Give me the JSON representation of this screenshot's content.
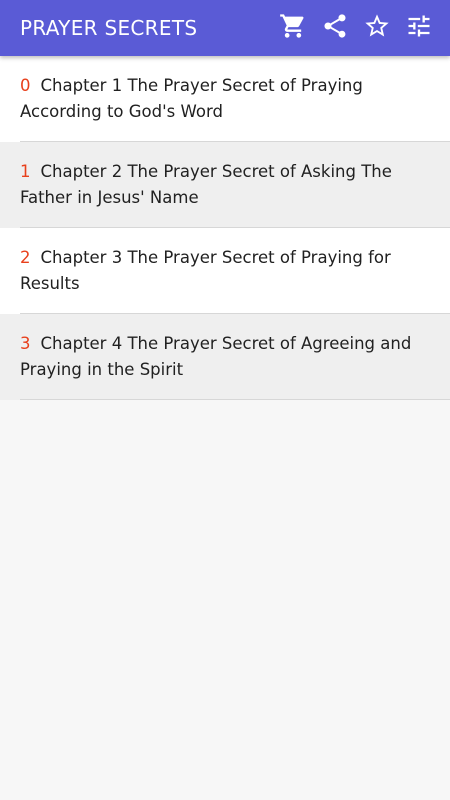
{
  "app": {
    "title": "PRAYER SECRETS",
    "bar_color": "#5a5bd6",
    "accent_color": "#e8401c"
  },
  "toolbar": {
    "icons": [
      "cart-icon",
      "share-icon",
      "star-outline-icon",
      "tune-icon"
    ]
  },
  "chapters": [
    {
      "number": "0",
      "title": "Chapter 1 The Prayer Secret of Praying According to God's Word"
    },
    {
      "number": "1",
      "title": "Chapter 2 The Prayer Secret of Asking The Father in Jesus' Name"
    },
    {
      "number": "2",
      "title": "Chapter 3 The Prayer Secret of Praying for Results"
    },
    {
      "number": "3",
      "title": "Chapter 4 The Prayer Secret of Agreeing and Praying in the Spirit"
    }
  ]
}
